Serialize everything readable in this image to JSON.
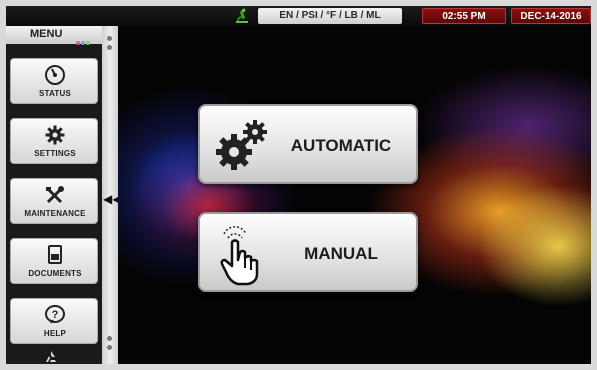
{
  "statusbar": {
    "units": "EN / PSI / °F / LB / ML",
    "time": "02:55 PM",
    "date": "DEC-14-2016"
  },
  "sidebar": {
    "title": "MENU",
    "items": [
      {
        "label": "STATUS",
        "icon": "gauge-icon"
      },
      {
        "label": "SETTINGS",
        "icon": "gear-icon"
      },
      {
        "label": "MAINTENANCE",
        "icon": "tools-icon"
      },
      {
        "label": "DOCUMENTS",
        "icon": "document-icon"
      },
      {
        "label": "HELP",
        "icon": "help-icon"
      }
    ],
    "bottom_icon": "recycle-icon",
    "collapse_icon": "double-chevron-left-icon"
  },
  "main": {
    "automatic_label": "AUTOMATIC",
    "manual_label": "MANUAL"
  },
  "colors": {
    "status_pill": "#7a0b0b",
    "panel_light": "#f2f2f2",
    "background": "#050505"
  }
}
